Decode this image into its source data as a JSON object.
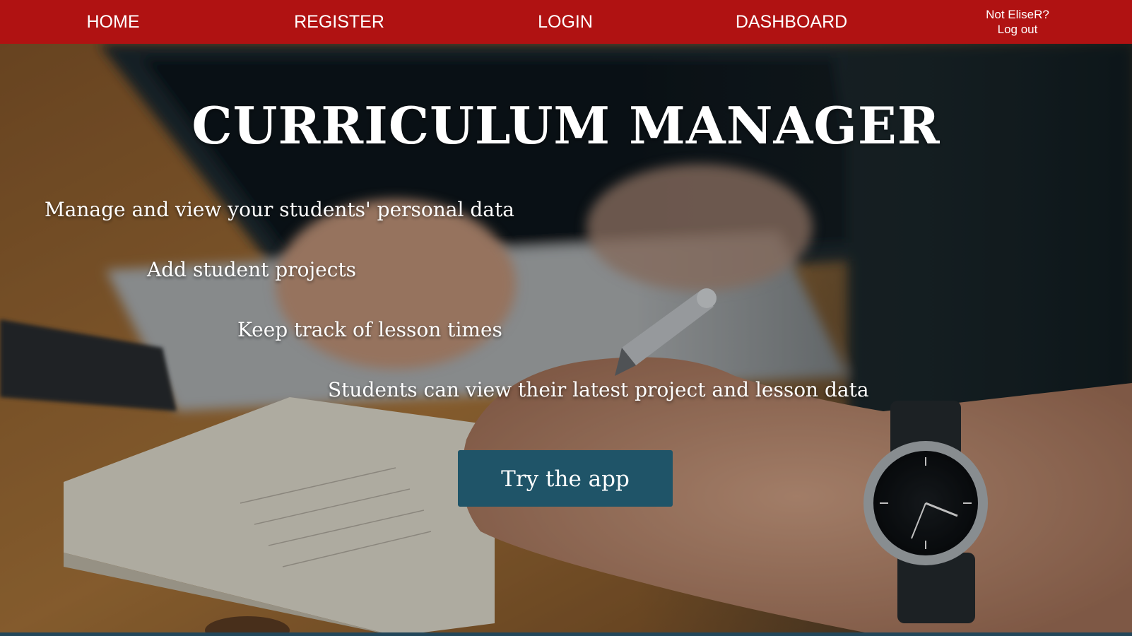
{
  "nav": {
    "home": "HOME",
    "register": "REGISTER",
    "login": "LOGIN",
    "dashboard": "DASHBOARD",
    "not_user": "Not EliseR?",
    "logout": "Log out"
  },
  "hero": {
    "title": "CURRICULUM MANAGER",
    "features": [
      "Manage and view your students' personal data",
      "Add student projects",
      "Keep track of lesson times",
      "Students can view their latest project and lesson data"
    ],
    "cta_label": "Try the app"
  },
  "colors": {
    "nav_bg": "#b01212",
    "button_bg": "#1f5468"
  }
}
